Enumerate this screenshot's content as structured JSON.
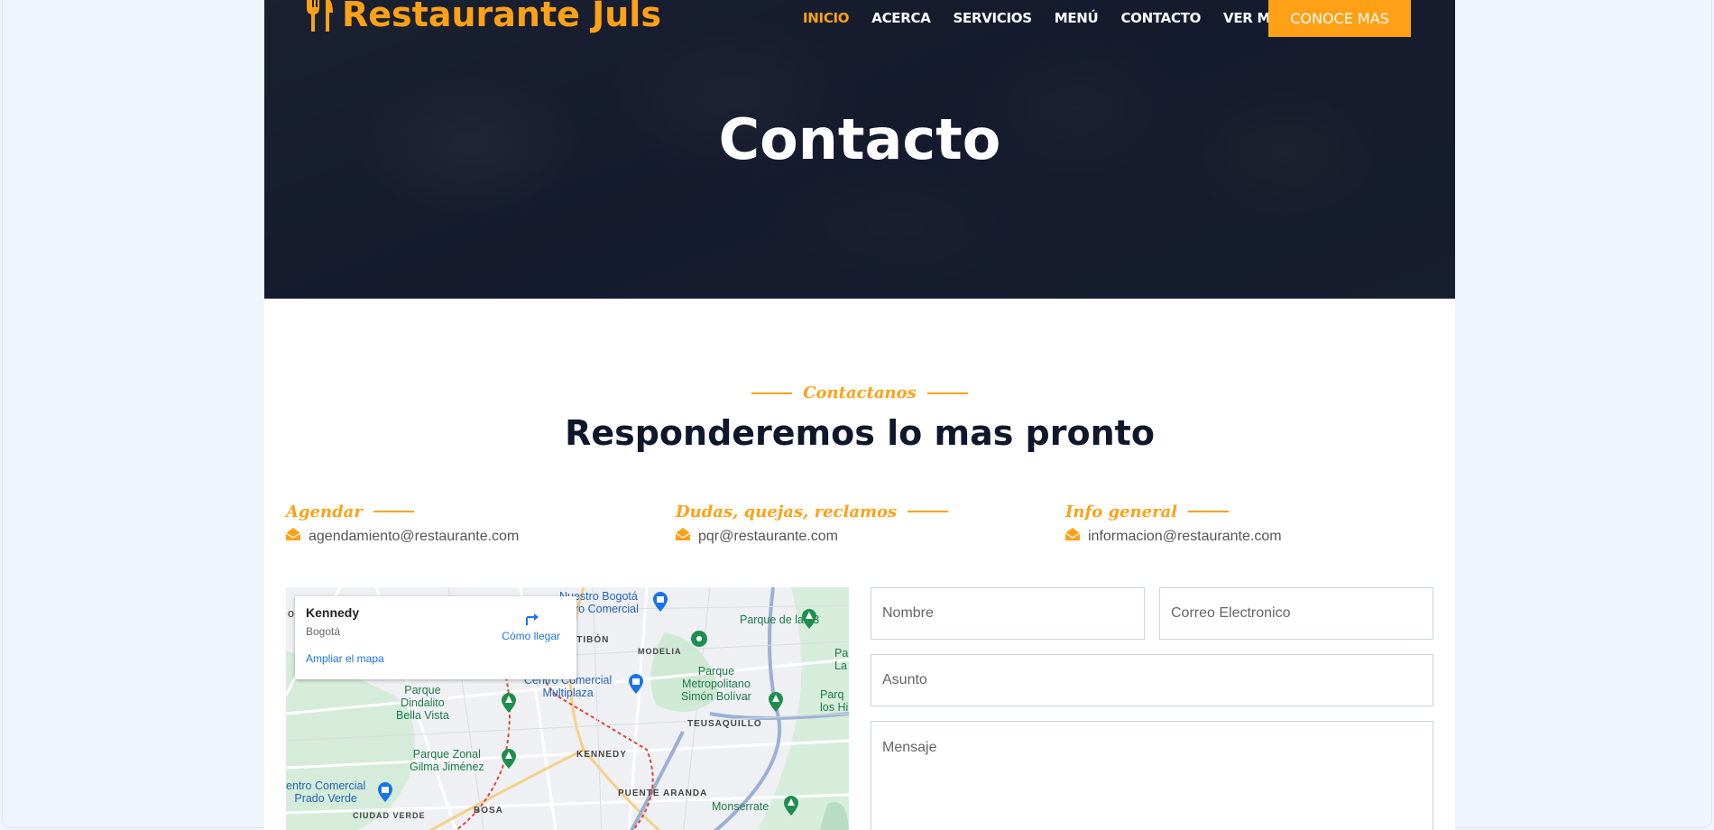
{
  "brand": {
    "name": "Restaurante Juls",
    "icon": "utensils-icon",
    "color": "#FEA116"
  },
  "nav": {
    "items": [
      {
        "label": "INICIO",
        "active": true
      },
      {
        "label": "ACERCA"
      },
      {
        "label": "SERVICIOS"
      },
      {
        "label": "MENÚ"
      },
      {
        "label": "CONTACTO"
      },
      {
        "label": "VER MAS"
      }
    ],
    "cta": "CONOCE MAS"
  },
  "hero": {
    "title": "Contacto"
  },
  "section": {
    "eyebrow": "Contactanos",
    "heading": "Responderemos lo mas pronto"
  },
  "contacts": [
    {
      "label": "Agendar",
      "email": "agendamiento@restaurante.com",
      "icon": "envelope-open-icon"
    },
    {
      "label": "Dudas, quejas, reclamos",
      "email": "pqr@restaurante.com",
      "icon": "envelope-open-icon"
    },
    {
      "label": "Info general",
      "email": "informacion@restaurante.com",
      "icon": "envelope-open-icon"
    }
  ],
  "map": {
    "place": "Kennedy",
    "city": "Bogotá",
    "directions": "Cómo llegar",
    "enlarge": "Ampliar el mapa",
    "labels": {
      "nuestro_bogota": "Nuestro Bogotá",
      "centro_comercial_top": "ro Comercial",
      "antibon": "NTIBÓN",
      "modelia": "MODELIA",
      "parque93": "Parque de la 93",
      "parque_metro": "Parque\nMetropolitano\nSimón Bolívar",
      "cc_multiplaza": "Centro Comercial\nMultiplaza",
      "parque_dindalito": "Parque\nDindalito\nBella Vista",
      "teusaquillo": "TEUSAQUILLO",
      "kennedy": "KENNEDY",
      "parque_zonal": "Parque Zonal\nGilma Jiménez",
      "puente_aranda": "PUENTE ARANDA",
      "cc_prado": "entro Comercial\nPrado Verde",
      "ciudad_verde": "CIUDAD VERDE",
      "bosa": "BOSA",
      "monserrate": "Monserrate",
      "pa_right": "Pa\nLa",
      "parque_hi": "Parq\nlos Hi",
      "left_o": "o"
    }
  },
  "form": {
    "name_placeholder": "Nombre",
    "email_placeholder": "Correo Electronico",
    "subject_placeholder": "Asunto",
    "message_placeholder": "Mensaje"
  }
}
